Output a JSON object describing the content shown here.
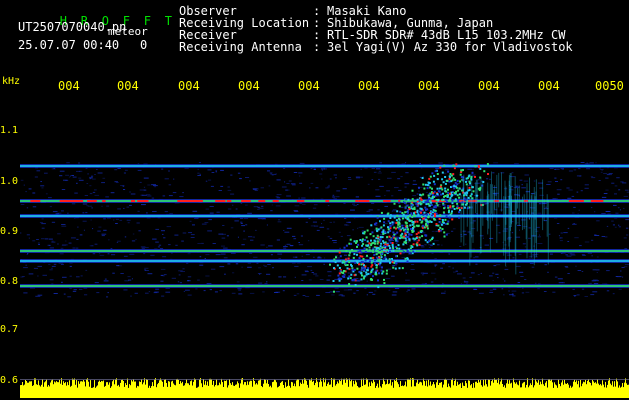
{
  "header": {
    "logo_letters": [
      "H",
      "R",
      "O",
      "F",
      "F",
      "T"
    ],
    "filename": "UT2507070040.pn",
    "meteor_label": "meteor",
    "datetime": "25.07.07 00:40",
    "count": "0"
  },
  "station_info": [
    {
      "label": "Observer",
      "value": "Masaki Kano"
    },
    {
      "label": "Receiving Location",
      "value": "Shibukawa, Gunma, Japan"
    },
    {
      "label": "Receiver",
      "value": "RTL-SDR SDR# 43dB L15 103.2MHz CW"
    },
    {
      "label": "Receiving Antenna",
      "value": "3el Yagi(V) Az 330 for Vladivostok"
    }
  ],
  "chart_data": {
    "type": "heatmap",
    "ylabel": "kHz",
    "y_ticks": [
      "1.1",
      "1.0",
      "0.9",
      "0.8",
      "0.7",
      "0.6"
    ],
    "x_ticks": [
      "004",
      "004",
      "004",
      "004",
      "004",
      "004",
      "004",
      "004",
      "004",
      "0050"
    ],
    "ylim": [
      0.6,
      1.15
    ],
    "horizontal_bands_khz": [
      1.03,
      0.96,
      0.93,
      0.86,
      0.84,
      0.79
    ],
    "meteor_trace": {
      "start_khz": 0.82,
      "end_khz": 1.0
    },
    "colors": {
      "background": "#000000",
      "noise_blue": "#1530c8",
      "band_cyan": "#20c8f0",
      "band_green": "#30e070",
      "hot_red": "#ff2020",
      "baseline_yellow": "#ffff00"
    }
  }
}
